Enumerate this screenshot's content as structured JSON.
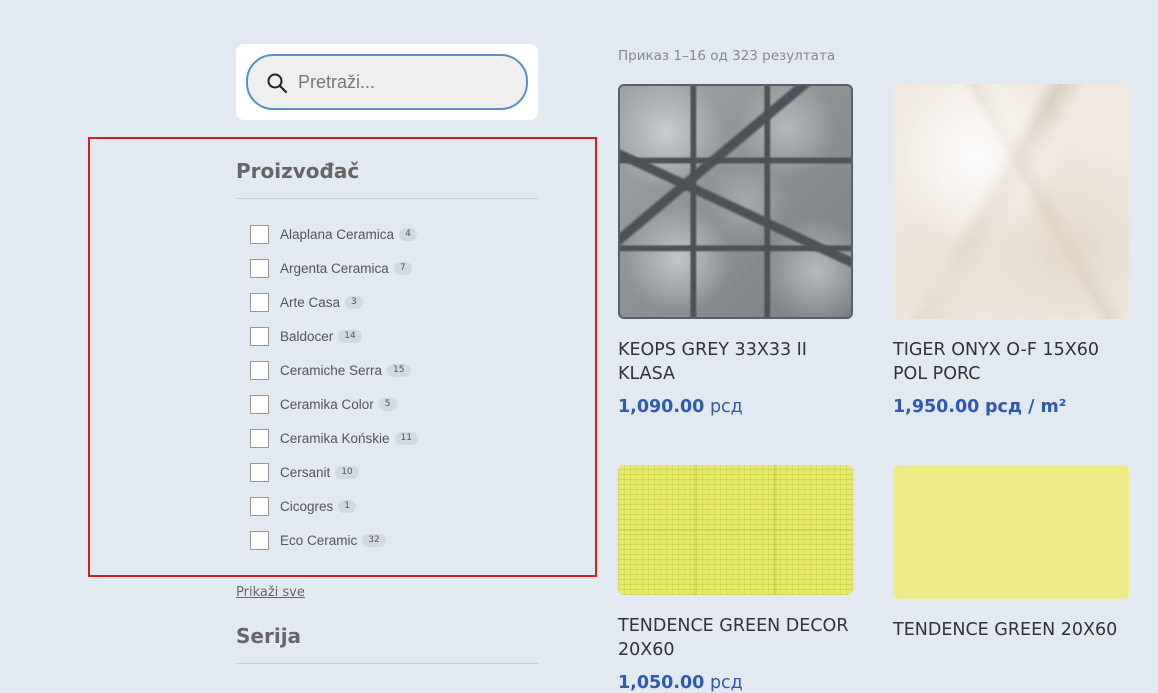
{
  "search": {
    "placeholder": "Pretraži..."
  },
  "filters": {
    "manufacturer": {
      "title": "Proizvođač",
      "items": [
        {
          "label": "Alaplana Ceramica",
          "count": "4"
        },
        {
          "label": "Argenta Ceramica",
          "count": "7"
        },
        {
          "label": "Arte Casa",
          "count": "3"
        },
        {
          "label": "Baldocer",
          "count": "14"
        },
        {
          "label": "Ceramiche Serra",
          "count": "15"
        },
        {
          "label": "Ceramika Color",
          "count": "5"
        },
        {
          "label": "Ceramika Końskie",
          "count": "11"
        },
        {
          "label": "Cersanit",
          "count": "10"
        },
        {
          "label": "Cicogres",
          "count": "1"
        },
        {
          "label": "Eco Ceramic",
          "count": "32"
        }
      ],
      "show_all": "Prikaži sve"
    },
    "series": {
      "title": "Serija"
    }
  },
  "results": {
    "count_text": "Приказ 1–16 од 323 резултата"
  },
  "products": [
    {
      "title": "KEOPS GREY 33X33 II KLASA",
      "price": "1,090.00",
      "unit": "рсд"
    },
    {
      "title": "TIGER ONYX O-F 15X60 POL PORC",
      "price": "1,950.00",
      "unit": "рсд / m²"
    },
    {
      "title": "TENDENCE GREEN DECOR 20X60",
      "price": "1,050.00",
      "unit": "рсд"
    },
    {
      "title": "TENDENCE GREEN 20X60"
    }
  ],
  "colors": {
    "highlight": "#dd1c1c",
    "price": "#2f59b5",
    "background": "#e3e9f1"
  }
}
